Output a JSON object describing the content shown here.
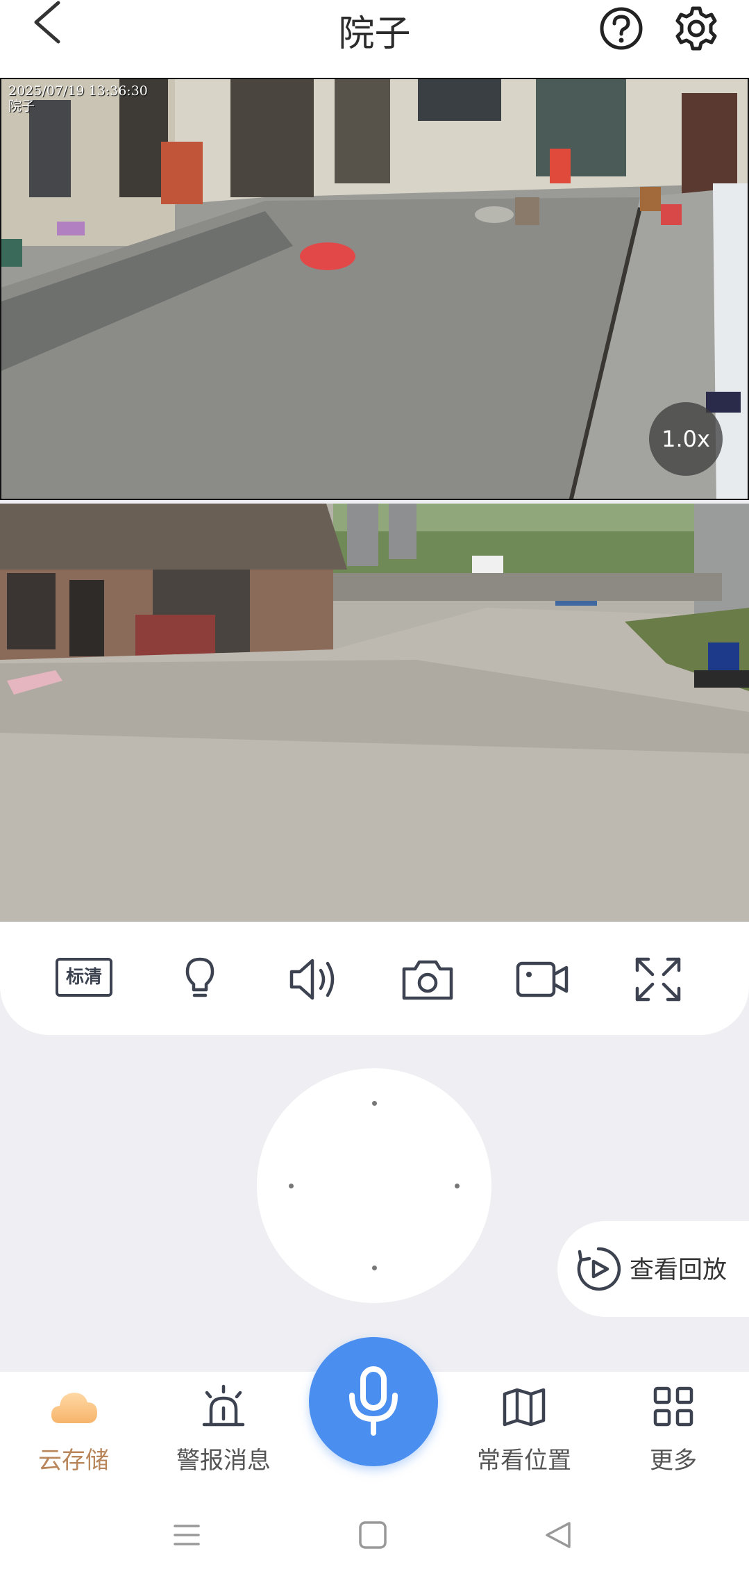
{
  "header": {
    "title": "院子"
  },
  "camera1": {
    "timestamp": "2025/07/19 13:36:30",
    "channel_name": "院子",
    "zoom": "1.0x"
  },
  "toolbar": {
    "quality_label": "标清"
  },
  "playback": {
    "label": "查看回放"
  },
  "nav": {
    "cloud": "云存储",
    "alarm": "警报消息",
    "favorites": "常看位置",
    "more": "更多"
  },
  "colors": {
    "accent": "#4a8ff0",
    "active_tab": "#b8865a",
    "background": "#eeeef3"
  },
  "icons": [
    "back-icon",
    "help-icon",
    "settings-icon",
    "light-icon",
    "speaker-icon",
    "camera-icon",
    "record-icon",
    "fullscreen-icon",
    "playback-icon",
    "cloud-icon",
    "alarm-icon",
    "map-icon",
    "grid-icon",
    "mic-icon"
  ]
}
